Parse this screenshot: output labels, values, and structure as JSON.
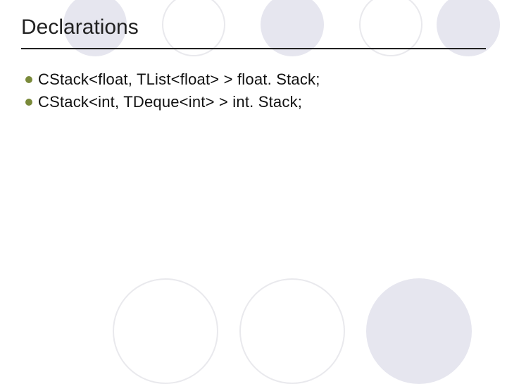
{
  "title": "Declarations",
  "bullets": [
    "CStack<float, TList<float> > float. Stack;",
    "CStack<int, TDeque<int> > int. Stack;"
  ]
}
